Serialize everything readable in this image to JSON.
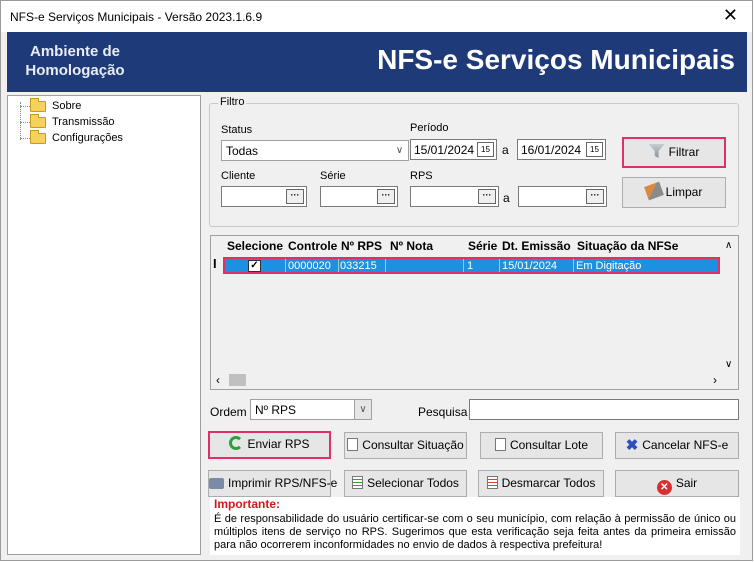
{
  "window": {
    "title": "NFS-e Serviços Municipais - Versão 2023.1.6.9",
    "close": "✕"
  },
  "banner": {
    "environment_line1": "Ambiente de",
    "environment_line2": "Homologação",
    "app_name": "NFS-e Serviços Municipais"
  },
  "tree": {
    "items": [
      "Sobre",
      "Transmissão",
      "Configurações"
    ]
  },
  "filter": {
    "legend": "Filtro",
    "status_label": "Status",
    "status_value": "Todas",
    "period_label": "Período",
    "period_from": "15/01/2024",
    "period_sep": "a",
    "period_to": "16/01/2024",
    "client_label": "Cliente",
    "series_label": "Série",
    "rps_label": "RPS",
    "rps_sep": "a",
    "filter_button": "Filtrar",
    "clear_button": "Limpar"
  },
  "grid": {
    "columns": [
      "Selecione",
      "Controle",
      "Nº RPS",
      "Nº Nota",
      "Série",
      "Dt. Emissão",
      "Situação da NFSe"
    ],
    "rows": [
      {
        "control": "0000020",
        "rps": "033215",
        "nota": "",
        "serie": "1",
        "emissao": "15/01/2024",
        "situacao": "Em Digitação"
      }
    ]
  },
  "order": {
    "label": "Ordem",
    "value": "Nº RPS",
    "search_label": "Pesquisa",
    "search_value": ""
  },
  "actions": {
    "send": "Enviar RPS",
    "consult_status": "Consultar Situação",
    "consult_batch": "Consultar Lote",
    "cancel": "Cancelar NFS-e",
    "print": "Imprimir RPS/NFS-e",
    "select_all": "Selecionar Todos",
    "deselect_all": "Desmarcar Todos",
    "exit": "Sair"
  },
  "note": {
    "title": "Importante:",
    "text": "É de responsabilidade do usuário certificar-se com o seu município, com relação à permissão de único ou múltiplos itens de serviço no RPS. Sugerimos que esta verificação seja feita antes da primeira emissão para não ocorrerem inconformidades no envio de dados à respectiva prefeitura!"
  },
  "colors": {
    "banner": "#1f3a78",
    "selection": "#1e90e0",
    "highlight": "#e0306a",
    "important": "#d11a1a"
  }
}
